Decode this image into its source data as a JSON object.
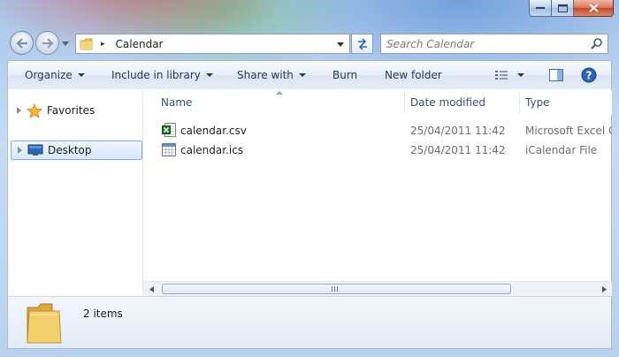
{
  "window": {
    "caption_buttons": {
      "minimize": "minimize",
      "maximize": "maximize",
      "close": "close"
    }
  },
  "address_bar": {
    "path_separator": "▸",
    "location": "Calendar"
  },
  "search": {
    "placeholder": "Search Calendar"
  },
  "toolbar": {
    "organize": "Organize",
    "include_in_library": "Include in library",
    "share_with": "Share with",
    "burn": "Burn",
    "new_folder": "New folder"
  },
  "nav_pane": {
    "items": [
      {
        "label": "Favorites",
        "icon": "star-icon"
      },
      {
        "label": "Desktop",
        "icon": "desktop-icon",
        "selected": true
      }
    ]
  },
  "columns": {
    "name": "Name",
    "date_modified": "Date modified",
    "type": "Type"
  },
  "files": [
    {
      "name": "calendar.csv",
      "date": "25/04/2011 11:42",
      "type": "Microsoft Excel Comma Separated Values File",
      "icon": "excel-file-icon"
    },
    {
      "name": "calendar.ics",
      "date": "25/04/2011 11:42",
      "type": "iCalendar File",
      "icon": "calendar-file-icon"
    }
  ],
  "details": {
    "item_count": "2 items"
  },
  "colors": {
    "accent": "#1e395b",
    "selection": "#d7e8fc",
    "frame": "#bcd3ee"
  }
}
